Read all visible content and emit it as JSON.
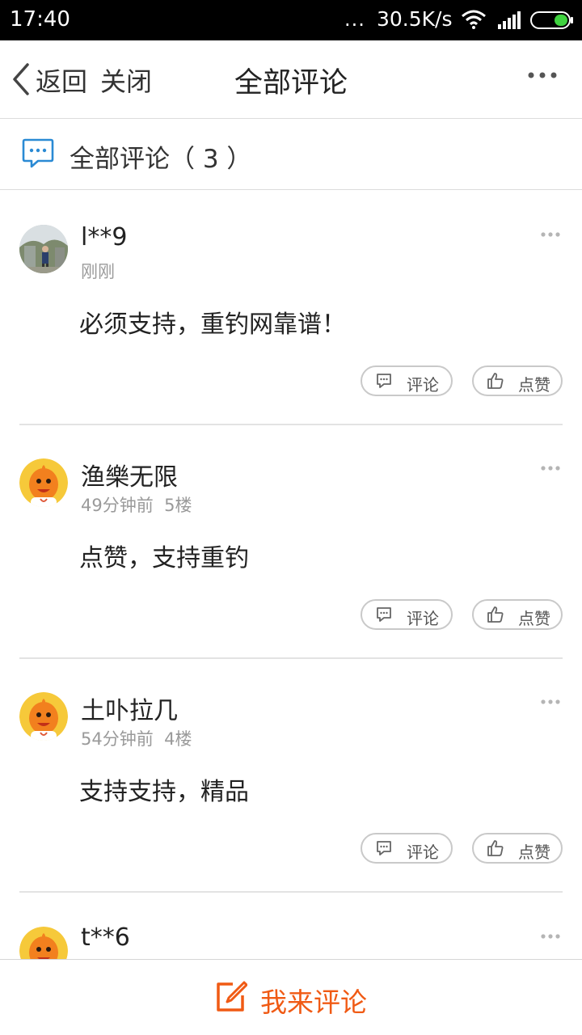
{
  "status_bar": {
    "time": "17:40",
    "dots": "...",
    "speed": "30.5K/s"
  },
  "navbar": {
    "back_label": "返回",
    "close_label": "关闭",
    "title": "全部评论"
  },
  "section": {
    "label": "全部评论（ 3 ）"
  },
  "comments": [
    {
      "user": "l**9",
      "time": "刚刚",
      "floor": "",
      "text": "必须支持，重钓网靠谱！",
      "reply_label": "评论",
      "like_label": "点赞"
    },
    {
      "user": "渔樂无限",
      "time": "49分钟前",
      "floor": "5楼",
      "text": "点赞，支持重钓",
      "reply_label": "评论",
      "like_label": "点赞"
    },
    {
      "user": "土卟拉几",
      "time": "54分钟前",
      "floor": "4楼",
      "text": "支持支持，精品",
      "reply_label": "评论",
      "like_label": "点赞"
    },
    {
      "user": "t**6"
    }
  ],
  "bottom_bar": {
    "label": "我来评论"
  },
  "colors": {
    "accent": "#f05a14",
    "chat_icon": "#2a8ad4",
    "avatar_orange": "#f2801e"
  }
}
